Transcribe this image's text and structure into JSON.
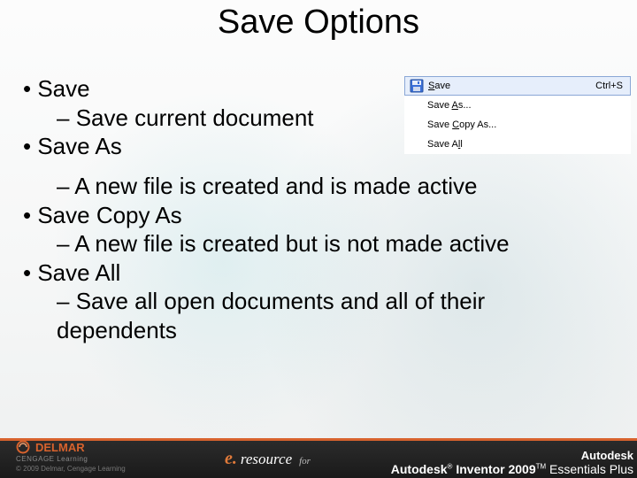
{
  "title": "Save Options",
  "bullets": {
    "save": "Save",
    "save_desc": "Save current document",
    "save_as": "Save As",
    "save_as_desc": "A new file is created and is made active",
    "save_copy_as": "Save Copy As",
    "save_copy_as_desc": " A new file is created but is not made active",
    "save_all": "Save All",
    "save_all_desc": "Save all open documents and all of their dependents"
  },
  "menu": {
    "items": [
      {
        "icon": "floppy",
        "pre": "",
        "u": "S",
        "post": "ave",
        "shortcut": "Ctrl+S",
        "highlight": true
      },
      {
        "icon": "",
        "pre": "Save ",
        "u": "A",
        "post": "s...",
        "shortcut": "",
        "highlight": false
      },
      {
        "icon": "",
        "pre": "Save ",
        "u": "C",
        "post": "opy As...",
        "shortcut": "",
        "highlight": false
      },
      {
        "icon": "",
        "pre": "Save A",
        "u": "l",
        "post": "l",
        "shortcut": "",
        "highlight": false
      }
    ]
  },
  "footer": {
    "delmar": "DELMAR",
    "delmar_sub": "CENGAGE Learning",
    "copyright": "© 2009 Delmar, Cengage Learning",
    "eresource_e": "e.",
    "eresource_rest": "resource",
    "eresource_for": "for",
    "autodesk": "Autodesk",
    "inventor_line": "Autodesk® Inventor 2009™ Essentials Plus"
  }
}
